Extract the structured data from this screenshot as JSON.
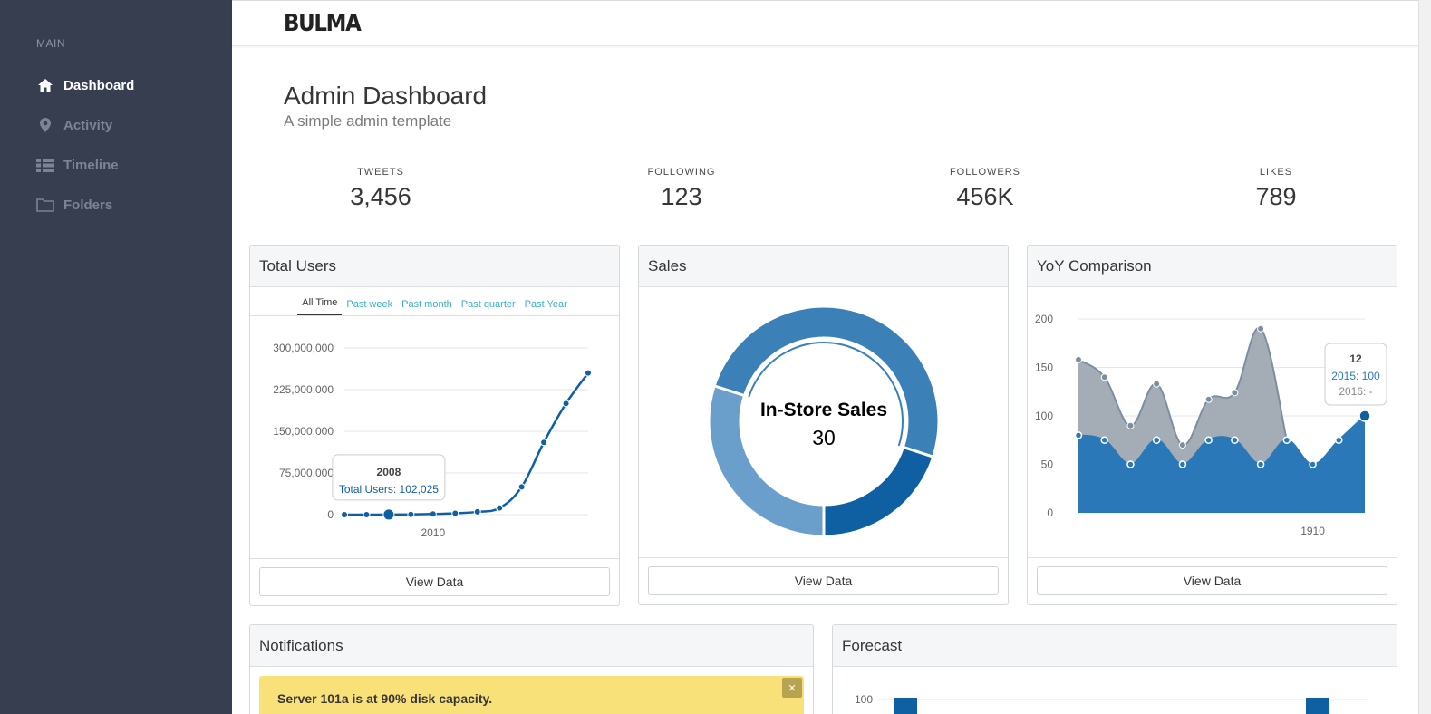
{
  "sidebar": {
    "section_label": "MAIN",
    "items": [
      {
        "label": "Dashboard",
        "icon": "home-icon",
        "active": true
      },
      {
        "label": "Activity",
        "icon": "map-marker-icon",
        "active": false
      },
      {
        "label": "Timeline",
        "icon": "list-icon",
        "active": false
      },
      {
        "label": "Folders",
        "icon": "folder-icon",
        "active": false
      }
    ]
  },
  "topbar": {
    "logo": "BULMA"
  },
  "header": {
    "title": "Admin Dashboard",
    "subtitle": "A simple admin template"
  },
  "stats": [
    {
      "label": "TWEETS",
      "value": "3,456"
    },
    {
      "label": "FOLLOWING",
      "value": "123"
    },
    {
      "label": "FOLLOWERS",
      "value": "456K"
    },
    {
      "label": "LIKES",
      "value": "789"
    }
  ],
  "cards": {
    "total_users": {
      "title": "Total Users",
      "tabs": [
        "All Time",
        "Past week",
        "Past month",
        "Past quarter",
        "Past Year"
      ],
      "active_tab": "All Time",
      "button": "View Data",
      "tooltip": {
        "title": "2008",
        "text": "Total Users: 102,025"
      }
    },
    "sales": {
      "title": "Sales",
      "center_label": "In-Store Sales",
      "center_value": "30",
      "button": "View Data"
    },
    "yoy": {
      "title": "YoY Comparison",
      "button": "View Data",
      "tooltip": {
        "title": "12",
        "line1": "2015: 100",
        "line2": "2016: -"
      }
    },
    "notifications": {
      "title": "Notifications",
      "message": "Server 101a is at 90% disk capacity.",
      "close": "×"
    },
    "forecast": {
      "title": "Forecast",
      "y_tick": "100"
    }
  },
  "colors": {
    "sidebar_bg": "#363e4f",
    "accent_blue": "#0f5fa3",
    "tab_link": "#3ab0c3",
    "notification_bg": "#f9e17a"
  },
  "chart_data": [
    {
      "type": "line",
      "title": "",
      "xlabel": "",
      "ylabel": "",
      "x_tick_labels": [
        "2010"
      ],
      "y_tick_labels": [
        "0",
        "75,000,000",
        "150,000,000",
        "225,000,000",
        "300,000,000"
      ],
      "ylim": [
        0,
        300000000
      ],
      "x": [
        2006,
        2007,
        2008,
        2009,
        2010,
        2011,
        2012,
        2013,
        2014,
        2015,
        2016,
        2017
      ],
      "values": [
        0,
        20000,
        102025,
        500000,
        1200000,
        2500000,
        5000000,
        12000000,
        50000000,
        130000000,
        200000000,
        255000000
      ],
      "highlight_index": 2
    },
    {
      "type": "pie",
      "donut": true,
      "slices": [
        {
          "label": "In-Store Sales",
          "value": 30,
          "color": "#6a9fcb"
        },
        {
          "label": "",
          "value": 50,
          "color": "#3b80b6"
        },
        {
          "label": "",
          "value": 20,
          "color": "#0f5fa3"
        }
      ]
    },
    {
      "type": "area",
      "title": "",
      "x_tick_labels": [
        "1910"
      ],
      "y_tick_labels": [
        "0",
        "50",
        "100",
        "150",
        "200"
      ],
      "ylim": [
        0,
        200
      ],
      "grid": true,
      "series": [
        {
          "name": "2015",
          "color": "#2a78b8",
          "values": [
            80,
            75,
            50,
            75,
            50,
            75,
            75,
            50,
            75,
            50,
            75,
            100
          ]
        },
        {
          "name": "2016",
          "color": "#a4adb6",
          "values": [
            158,
            140,
            90,
            133,
            70,
            117,
            124,
            190,
            75,
            null,
            null,
            null
          ]
        }
      ]
    }
  ]
}
